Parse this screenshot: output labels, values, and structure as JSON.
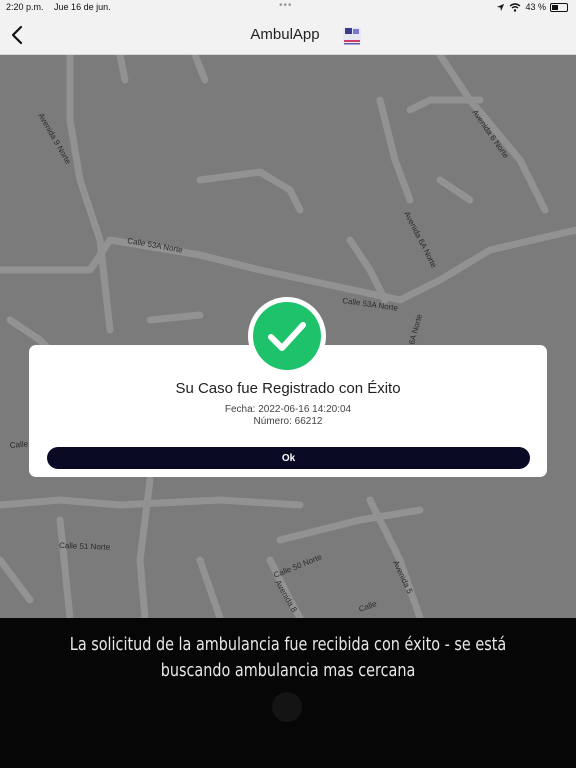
{
  "status_bar": {
    "time": "2:20 p.m.",
    "date": "Jue 16 de jun.",
    "battery": "43 %",
    "battery_level": 0.43
  },
  "nav": {
    "title": "AmbulApp",
    "back_icon": "chevron-left-icon",
    "logo_icon": "app-logo-icon"
  },
  "map": {
    "streets": [
      "Avenida 9 Norte",
      "Avenida 6 Norte",
      "Calle 53A Norte",
      "Avenida 6A Norte",
      "Calle 53A Norte",
      "Calle 51 Norte",
      "Calle 50 Norte",
      "Avenida 8",
      "Avenida 5",
      "Calle",
      "Calle",
      "6A Norte"
    ]
  },
  "dialog": {
    "title": "Su Caso fue Registrado con Éxito",
    "date_line": "Fecha: 2022-06-16 14:20:04",
    "number_line": "Número: 66212",
    "ok_label": "Ok",
    "icon": "check-circle-icon"
  },
  "notice": {
    "message": "La solicitud de la ambulancia fue recibida con éxito - se está buscando ambulancia mas cercana"
  },
  "colors": {
    "success": "#1ec26a",
    "button": "#0a0a25",
    "overlay": "#060606"
  }
}
